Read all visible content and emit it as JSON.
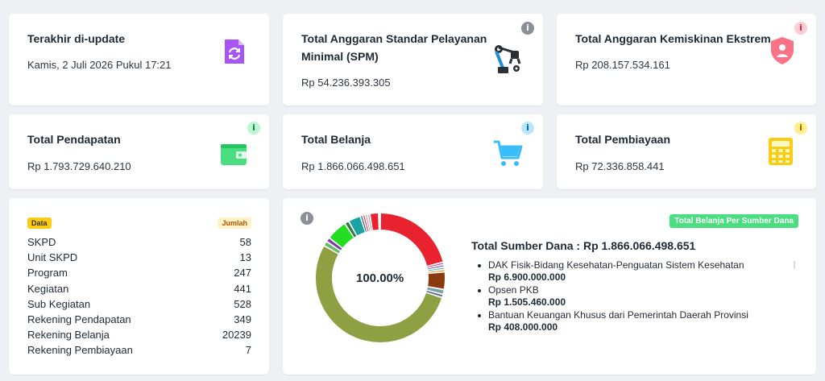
{
  "cards": {
    "last_update": {
      "title": "Terakhir di-update",
      "value": "Kamis, 2 Juli 2026 Pukul 17:21",
      "icon": "file-sync-icon",
      "color": "#a855f7"
    },
    "spm": {
      "title_line1": "Total Anggaran Standar Pelayanan",
      "title_line2": "Minimal (SPM)",
      "value": "Rp 54.236.393.305",
      "icon": "robotic-arm-icon",
      "info": "i"
    },
    "poverty": {
      "title": "Total Anggaran Kemiskinan Ekstrem",
      "value": "Rp 208.157.534.161",
      "icon": "user-shield-icon",
      "info": "i",
      "color": "#fb7185"
    },
    "revenue": {
      "title": "Total Pendapatan",
      "value": "Rp 1.793.729.640.210",
      "icon": "wallet-icon",
      "info": "i",
      "color": "#4ade80"
    },
    "spending": {
      "title": "Total Belanja",
      "value": "Rp 1.866.066.498.651",
      "icon": "shopping-cart-icon",
      "info": "i",
      "color": "#38bdf8"
    },
    "financing": {
      "title": "Total Pembiayaan",
      "value": "Rp 72.336.858.441",
      "icon": "calculator-icon",
      "info": "i",
      "color": "#facc15"
    }
  },
  "stats": {
    "header_data": "Data",
    "header_count": "Jumlah",
    "rows": [
      {
        "label": "SKPD",
        "value": "58"
      },
      {
        "label": "Unit SKPD",
        "value": "13"
      },
      {
        "label": "Program",
        "value": "247"
      },
      {
        "label": "Kegiatan",
        "value": "441"
      },
      {
        "label": "Sub Kegiatan",
        "value": "528"
      },
      {
        "label": "Rekening Pendapatan",
        "value": "349"
      },
      {
        "label": "Rekening Belanja",
        "value": "20239"
      },
      {
        "label": "Rekening Pembiayaan",
        "value": "7"
      }
    ]
  },
  "funding": {
    "badge": "Total Belanja Per Sumber Dana",
    "info": "i",
    "total_label": "Total Sumber Dana : Rp 1.866.066.498.651",
    "center_label": "100.00%",
    "items": [
      {
        "name": "DAK Fisik-Bidang Kesehatan-Penguatan Sistem Kesehatan",
        "amount": "Rp 6.900.000.000"
      },
      {
        "name": "Opsen PKB",
        "amount": "Rp 1.505.460.000"
      },
      {
        "name": "Bantuan Keuangan Khusus dari Pemerintah Daerah Provinsi",
        "amount": "Rp 408.000.000"
      }
    ],
    "donut_segments": [
      {
        "share": 0.211,
        "color": "#e8222e"
      },
      {
        "share": 0.006,
        "color": "#e83e8c"
      },
      {
        "share": 0.006,
        "color": "#6f42c1"
      },
      {
        "share": 0.006,
        "color": "#20c997"
      },
      {
        "share": 0.006,
        "color": "#fd7e14"
      },
      {
        "share": 0.044,
        "color": "#8b3a0f"
      },
      {
        "share": 0.012,
        "color": "#7aa0a8"
      },
      {
        "share": 0.008,
        "color": "#5f6b8a"
      },
      {
        "share": 0.534,
        "color": "#8fa043"
      },
      {
        "share": 0.012,
        "color": "#66bb6a"
      },
      {
        "share": 0.011,
        "color": "#7b3fa0"
      },
      {
        "share": 0.052,
        "color": "#22dd22"
      },
      {
        "share": 0.011,
        "color": "#2c7a3c"
      },
      {
        "share": 0.031,
        "color": "#1aa3a3"
      },
      {
        "share": 0.006,
        "color": "#1f3f8a"
      },
      {
        "share": 0.006,
        "color": "#c0392b"
      },
      {
        "share": 0.006,
        "color": "#e87ab0"
      },
      {
        "share": 0.006,
        "color": "#a0a0a0"
      },
      {
        "share": 0.022,
        "color": "#e8222e"
      }
    ]
  }
}
